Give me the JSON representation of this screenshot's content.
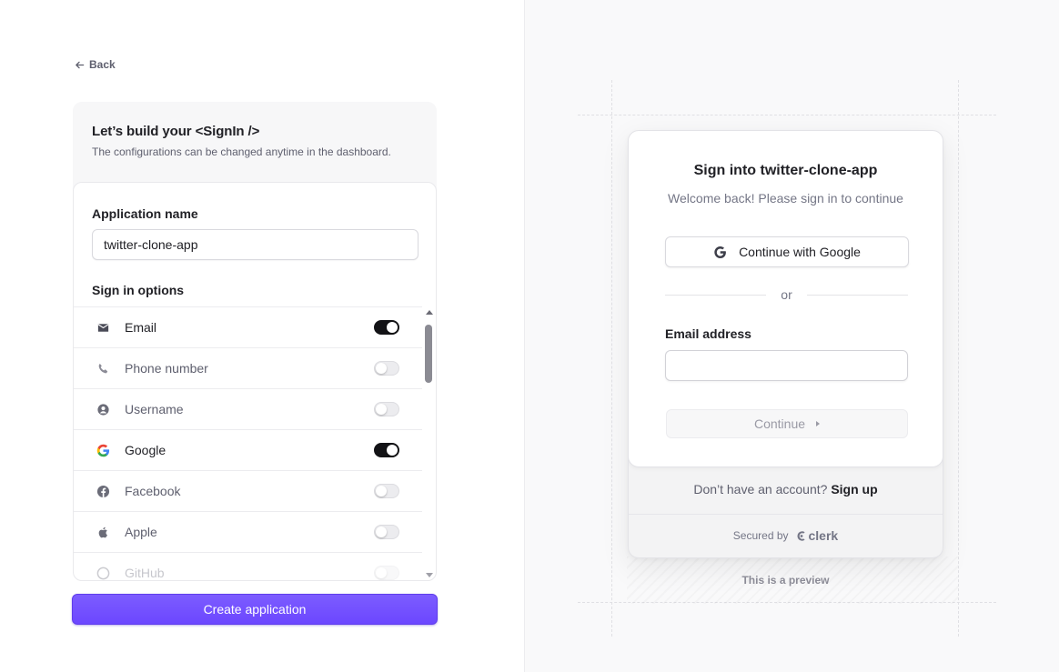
{
  "nav": {
    "back_label": "Back"
  },
  "config": {
    "title": "Let’s build your <SignIn />",
    "subtitle": "The configurations can be changed anytime in the dashboard.",
    "app_name_label": "Application name",
    "app_name_value": "twitter-clone-app",
    "sign_in_options_label": "Sign in options",
    "options": [
      {
        "label": "Email",
        "icon": "envelope-icon",
        "enabled": true
      },
      {
        "label": "Phone number",
        "icon": "phone-icon",
        "enabled": false
      },
      {
        "label": "Username",
        "icon": "user-circle-icon",
        "enabled": false
      },
      {
        "label": "Google",
        "icon": "google-icon",
        "enabled": true
      },
      {
        "label": "Facebook",
        "icon": "facebook-icon",
        "enabled": false
      },
      {
        "label": "Apple",
        "icon": "apple-icon",
        "enabled": false
      },
      {
        "label": "GitHub",
        "icon": "github-icon",
        "enabled": false
      }
    ],
    "create_button_label": "Create application",
    "accent_color": "#6c47ff"
  },
  "preview": {
    "title": "Sign into twitter-clone-app",
    "subtitle": "Welcome back! Please sign in to continue",
    "google_button_label": "Continue with Google",
    "divider_text": "or",
    "email_label": "Email address",
    "email_value": "",
    "continue_label": "Continue",
    "no_account_text": "Don’t have an account?",
    "signup_label": "Sign up",
    "secured_by_text": "Secured by",
    "clerk_brand": "clerk",
    "preview_note": "This is a preview"
  }
}
